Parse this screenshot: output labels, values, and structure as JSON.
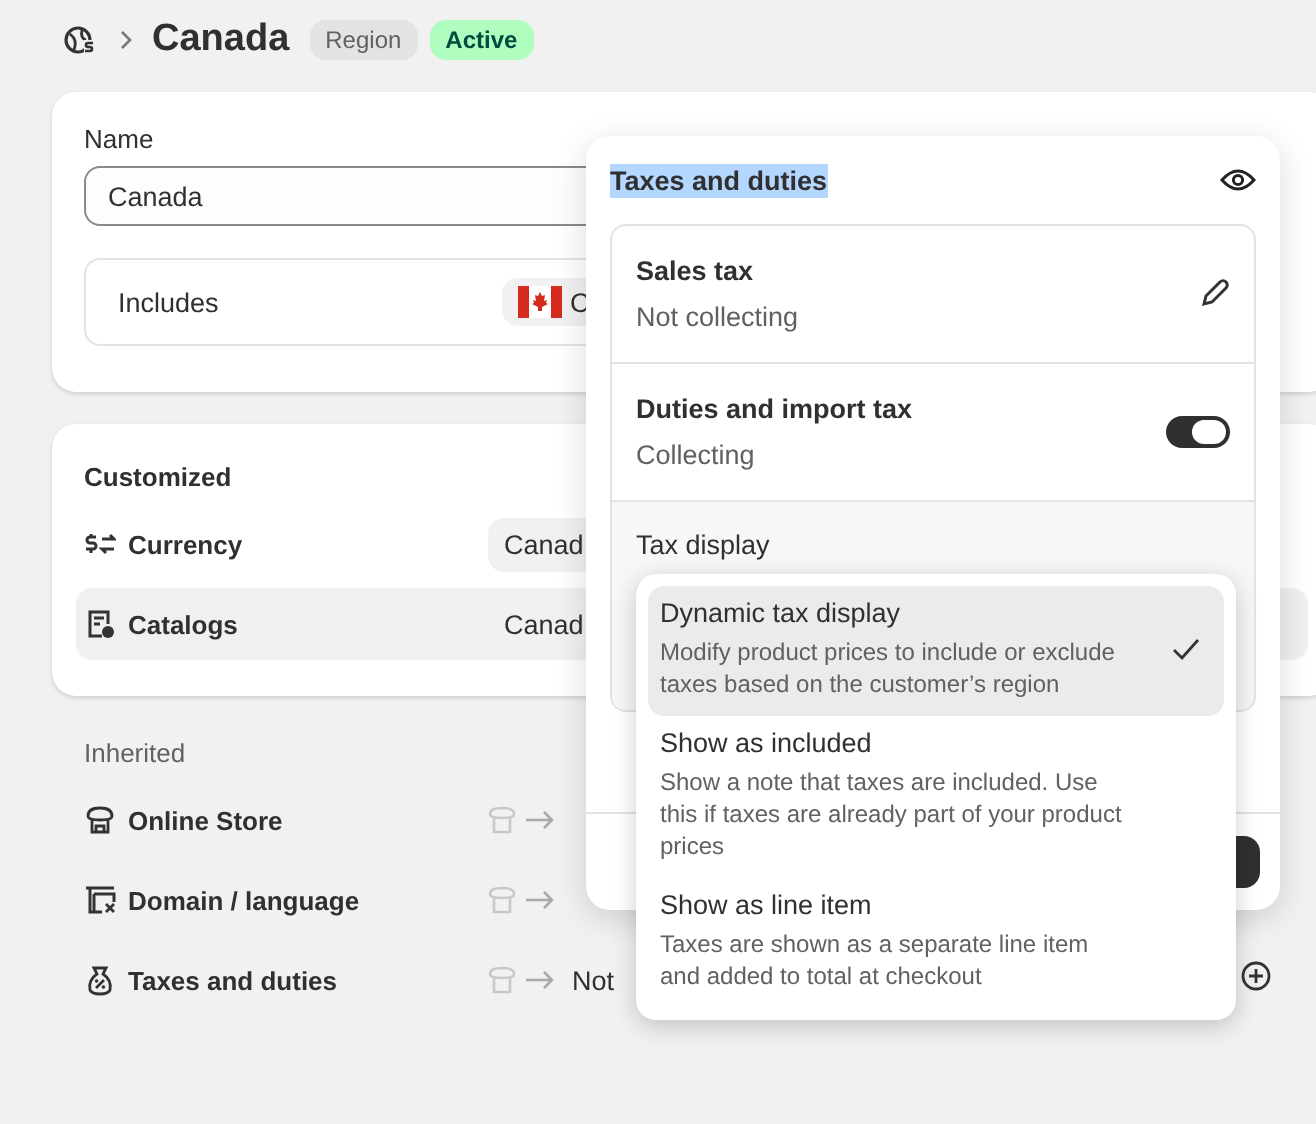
{
  "header": {
    "title": "Canada",
    "badges": [
      {
        "label": "Region",
        "kind": "neutral"
      },
      {
        "label": "Active",
        "kind": "success"
      }
    ]
  },
  "details_card": {
    "name_label": "Name",
    "name_value": "Canada",
    "includes_label": "Includes",
    "includes_chip": "C"
  },
  "customized": {
    "heading": "Customized",
    "rows": [
      {
        "label": "Currency",
        "value": "Canad",
        "kind": "currency",
        "selected": false
      },
      {
        "label": "Catalogs",
        "value": "Canad",
        "kind": "catalogs",
        "selected": true
      }
    ]
  },
  "inherited": {
    "heading": "Inherited",
    "rows": [
      {
        "label": "Online Store",
        "kind": "store"
      },
      {
        "label": "Domain / language",
        "kind": "domain"
      },
      {
        "label": "Taxes and duties",
        "kind": "taxes",
        "value": "Not"
      }
    ]
  },
  "popover": {
    "title": "Taxes and duties",
    "title_highlighted": true,
    "settings": [
      {
        "title": "Sales tax",
        "status": "Not collecting",
        "kind": "edit"
      },
      {
        "title": "Duties and import tax",
        "status": "Collecting",
        "kind": "toggle",
        "on": true
      }
    ],
    "tax_display_label": "Tax display"
  },
  "dropdown": {
    "options": [
      {
        "title": "Dynamic tax display",
        "description": "Modify product prices to include or exclude taxes based on the customer’s region",
        "selected": true
      },
      {
        "title": "Show as included",
        "description": "Show a note that taxes are included. Use this if taxes are already part of your product prices",
        "selected": false
      },
      {
        "title": "Show as line item",
        "description": "Taxes are shown as a separate line item and added to total at checkout",
        "selected": false
      }
    ]
  }
}
